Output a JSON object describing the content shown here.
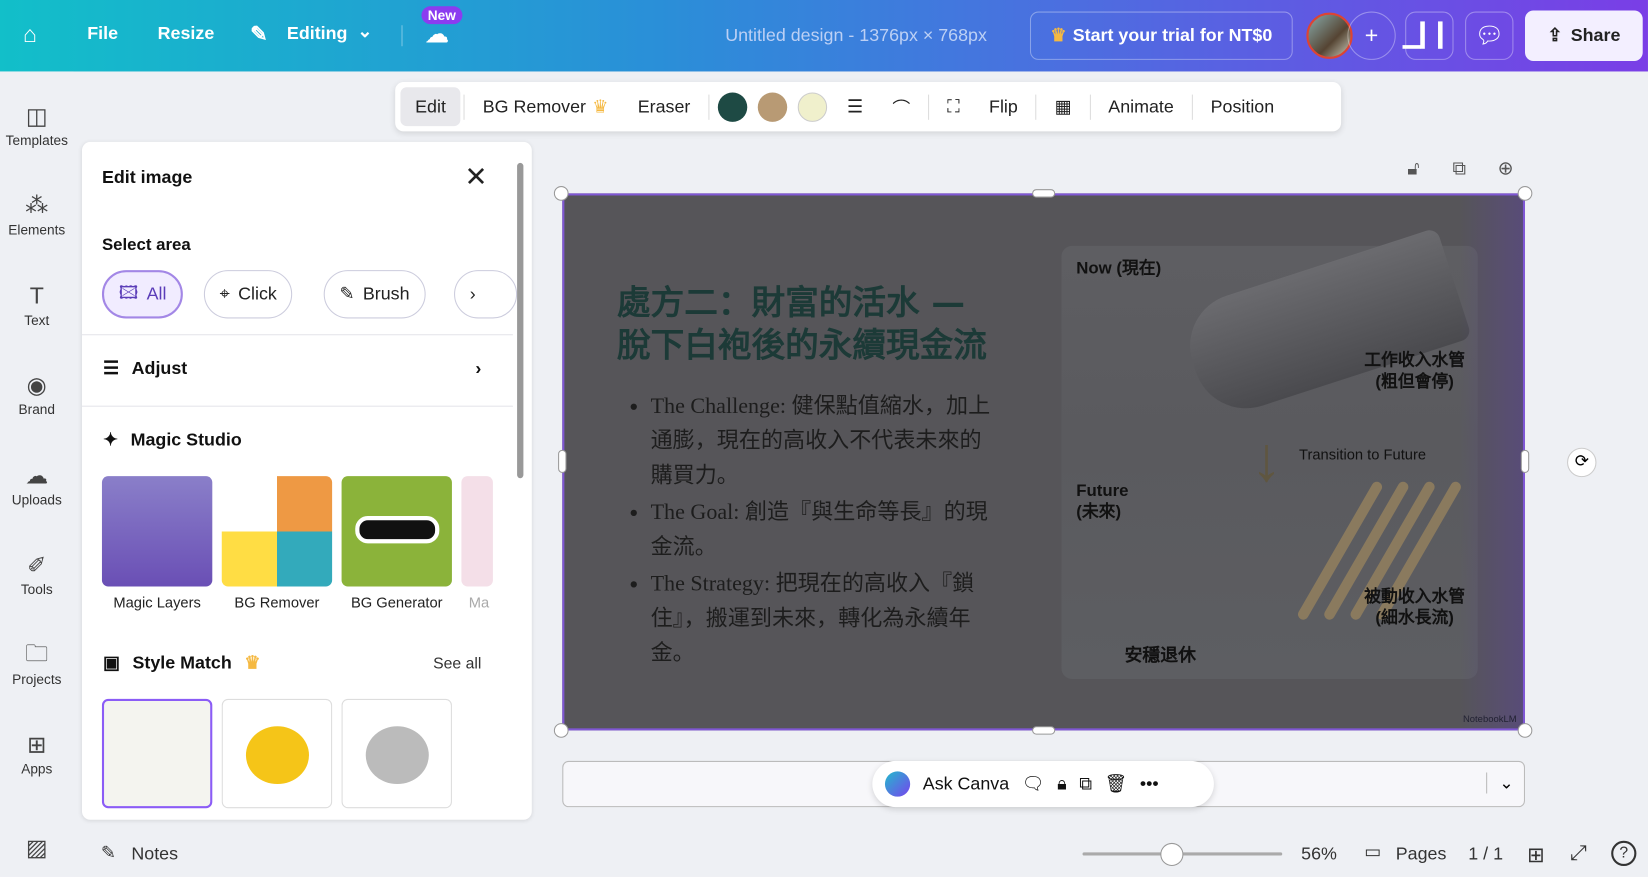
{
  "topbar": {
    "file": "File",
    "resize": "Resize",
    "editing": "Editing",
    "new_badge": "New",
    "title": "Untitled design - 1376px × 768px",
    "trial": "Start your trial for NT$0",
    "share": "Share"
  },
  "sidebar": {
    "items": [
      {
        "label": "Templates"
      },
      {
        "label": "Elements"
      },
      {
        "label": "Text"
      },
      {
        "label": "Brand"
      },
      {
        "label": "Uploads"
      },
      {
        "label": "Tools"
      },
      {
        "label": "Projects"
      },
      {
        "label": "Apps"
      }
    ]
  },
  "panel": {
    "title": "Edit image",
    "select_area": "Select area",
    "modes": [
      "All",
      "Click",
      "Brush"
    ],
    "adjust": "Adjust",
    "magic_studio": "Magic Studio",
    "tools": [
      "Magic Layers",
      "BG Remover",
      "BG Generator",
      "Ma"
    ],
    "style_match": "Style Match",
    "see_all": "See all"
  },
  "toolbar": {
    "edit": "Edit",
    "bg_remover": "BG Remover",
    "eraser": "Eraser",
    "flip": "Flip",
    "animate": "Animate",
    "position": "Position",
    "colors": [
      "#1e4a44",
      "#b89a74",
      "#f0f0cc"
    ]
  },
  "slide": {
    "title_line1": "處方二：財富的活水 —",
    "title_line2": "脫下白袍後的永續現金流",
    "bullets": [
      "The Challenge: 健保點值縮水，加上通膨，現在的高收入不代表未來的購買力。",
      "The Goal: 創造『與生命等長』的現金流。",
      "The Strategy: 把現在的高收入『鎖住』，搬運到未來，轉化為永續年金。"
    ],
    "now": "Now (現在)",
    "pipe1_l1": "工作收入水管",
    "pipe1_l2": "(粗但會停)",
    "transition": "Transition to Future",
    "future_l1": "Future",
    "future_l2": "(未來)",
    "pipe2_l1": "被動收入水管",
    "pipe2_l2": "(細水長流)",
    "pool": "安穩退休",
    "watermark": "NotebookLM"
  },
  "askbar": {
    "label": "Ask Canva"
  },
  "bottom": {
    "notes": "Notes",
    "zoom": "56%",
    "zoom_value": 56,
    "pages": "Pages",
    "page_count": "1 / 1"
  }
}
